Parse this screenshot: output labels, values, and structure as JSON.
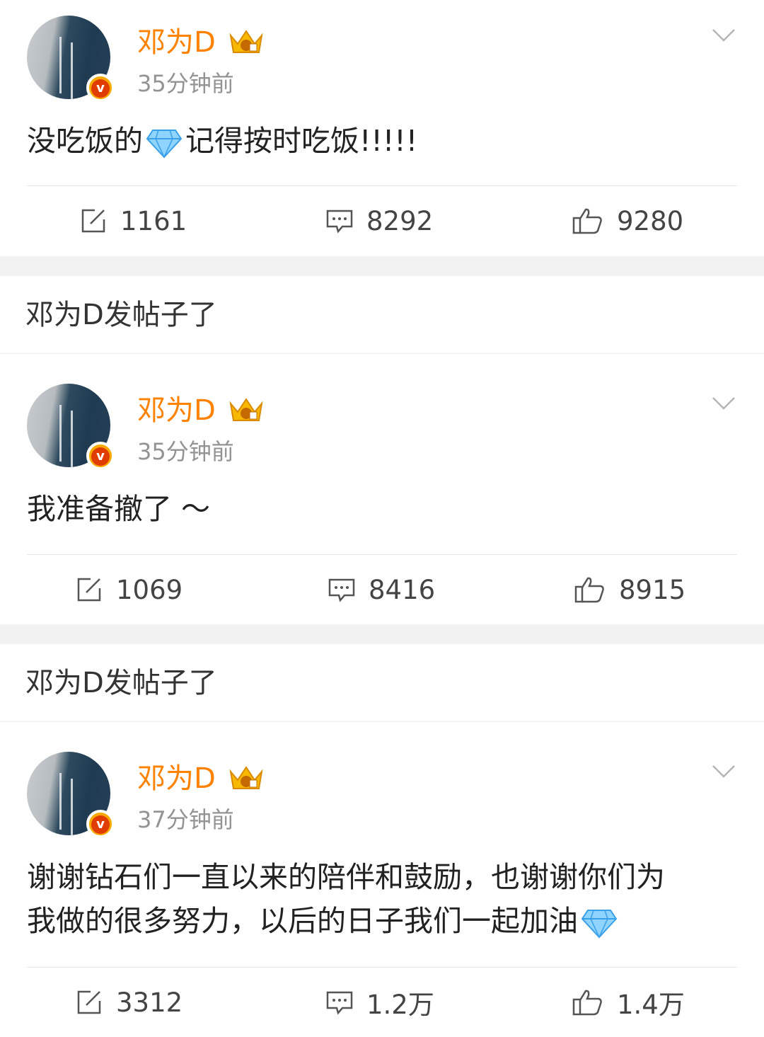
{
  "posts": [
    {
      "author": "邓为D",
      "time": "35分钟前",
      "content": [
        "没吃饭的",
        "记得按时吃饭!!!!!"
      ],
      "repost": "1161",
      "comment": "8292",
      "like": "9280"
    },
    {
      "notice": "邓为D发帖子了",
      "author": "邓为D",
      "time": "35分钟前",
      "content": [
        "我准备撤了 ～"
      ],
      "repost": "1069",
      "comment": "8416",
      "like": "8915"
    },
    {
      "notice": "邓为D发帖子了",
      "author": "邓为D",
      "time": "37分钟前",
      "content": [
        "谢谢钻石们一直以来的陪伴和鼓励，也谢谢你们为",
        "我做的很多努力，以后的日子我们一起加油"
      ],
      "repost": "3312",
      "comment": "1.2万",
      "like": "1.4万"
    }
  ],
  "icons": {
    "repost": "repost-icon",
    "comment": "comment-icon",
    "like": "like-icon",
    "verified": "verified-badge-icon",
    "crown": "crown-icon",
    "menu": "chevron-down-icon",
    "gem": "diamond-emoji-icon"
  },
  "verified_letter": "v",
  "colors": {
    "name": "#ff8200",
    "time": "#939393",
    "gap": "#f2f2f2",
    "badge": "#f7a900"
  }
}
